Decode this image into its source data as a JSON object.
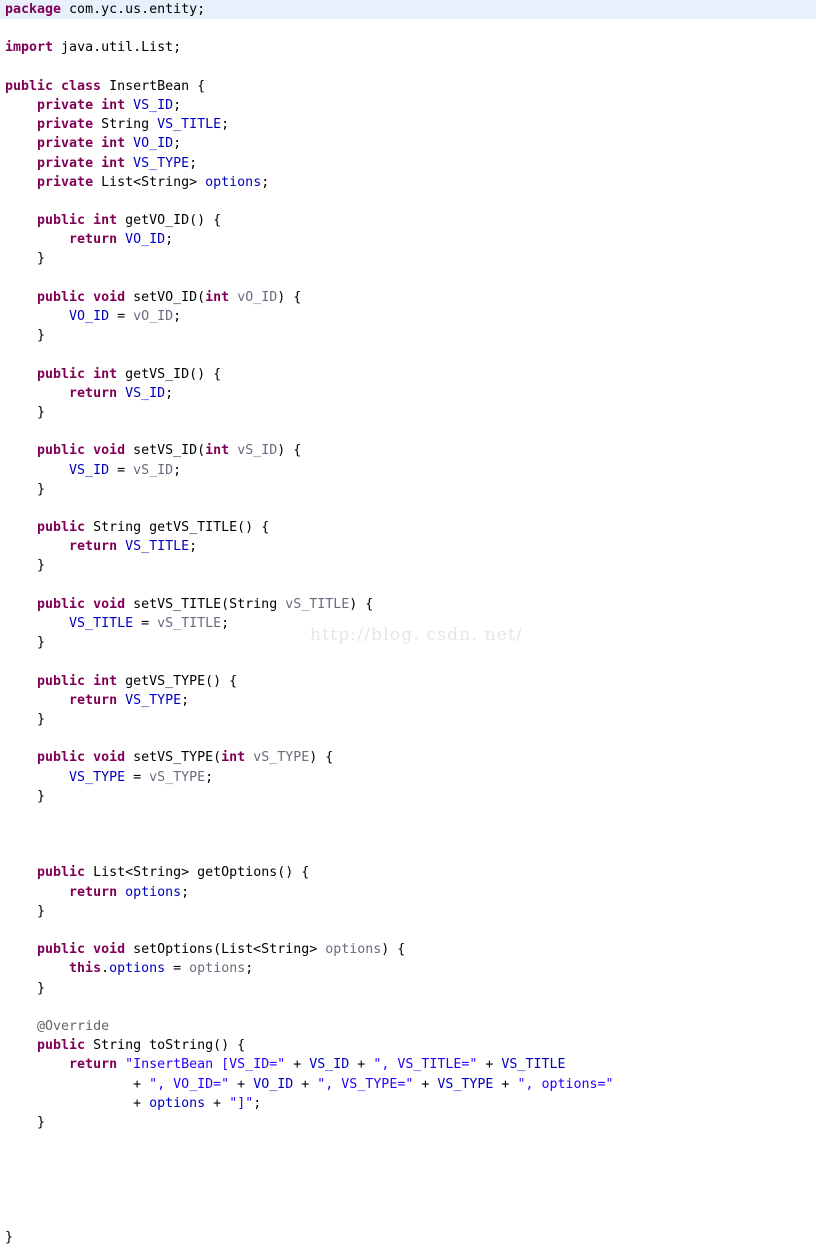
{
  "editor": {
    "language": "java",
    "theme": "eclipse-light",
    "background_color": "#ffffff",
    "current_line_highlight_color": "#e8f0fc",
    "colors": {
      "keyword": "#7f0055",
      "field": "#0000c0",
      "string": "#2a00ff",
      "parameter": "#6a6a80",
      "annotation": "#646464",
      "plain": "#000000"
    }
  },
  "watermark": {
    "text": "http://blog. csdn. net/"
  },
  "code": {
    "lines": [
      {
        "n": 1,
        "highlight": true,
        "tokens": [
          {
            "t": "kw",
            "v": "package"
          },
          {
            "t": "pln",
            "v": " com.yc.us.entity;"
          }
        ]
      },
      {
        "n": 2,
        "highlight": false,
        "tokens": []
      },
      {
        "n": 3,
        "highlight": false,
        "tokens": [
          {
            "t": "kw",
            "v": "import"
          },
          {
            "t": "pln",
            "v": " java.util.List;"
          }
        ]
      },
      {
        "n": 4,
        "highlight": false,
        "tokens": []
      },
      {
        "n": 5,
        "highlight": false,
        "tokens": [
          {
            "t": "kw",
            "v": "public class"
          },
          {
            "t": "pln",
            "v": " InsertBean {"
          }
        ]
      },
      {
        "n": 6,
        "highlight": false,
        "tokens": [
          {
            "t": "pln",
            "v": "    "
          },
          {
            "t": "kw",
            "v": "private int"
          },
          {
            "t": "pln",
            "v": " "
          },
          {
            "t": "fld",
            "v": "VS_ID"
          },
          {
            "t": "pln",
            "v": ";"
          }
        ]
      },
      {
        "n": 7,
        "highlight": false,
        "tokens": [
          {
            "t": "pln",
            "v": "    "
          },
          {
            "t": "kw",
            "v": "private"
          },
          {
            "t": "pln",
            "v": " String "
          },
          {
            "t": "fld",
            "v": "VS_TITLE"
          },
          {
            "t": "pln",
            "v": ";"
          }
        ]
      },
      {
        "n": 8,
        "highlight": false,
        "tokens": [
          {
            "t": "pln",
            "v": "    "
          },
          {
            "t": "kw",
            "v": "private int"
          },
          {
            "t": "pln",
            "v": " "
          },
          {
            "t": "fld",
            "v": "VO_ID"
          },
          {
            "t": "pln",
            "v": ";"
          }
        ]
      },
      {
        "n": 9,
        "highlight": false,
        "tokens": [
          {
            "t": "pln",
            "v": "    "
          },
          {
            "t": "kw",
            "v": "private int"
          },
          {
            "t": "pln",
            "v": " "
          },
          {
            "t": "fld",
            "v": "VS_TYPE"
          },
          {
            "t": "pln",
            "v": ";"
          }
        ]
      },
      {
        "n": 10,
        "highlight": false,
        "tokens": [
          {
            "t": "pln",
            "v": "    "
          },
          {
            "t": "kw",
            "v": "private"
          },
          {
            "t": "pln",
            "v": " List<String> "
          },
          {
            "t": "fld",
            "v": "options"
          },
          {
            "t": "pln",
            "v": ";"
          }
        ]
      },
      {
        "n": 11,
        "highlight": false,
        "tokens": []
      },
      {
        "n": 12,
        "highlight": false,
        "tokens": [
          {
            "t": "pln",
            "v": "    "
          },
          {
            "t": "kw",
            "v": "public int"
          },
          {
            "t": "pln",
            "v": " getVO_ID() {"
          }
        ]
      },
      {
        "n": 13,
        "highlight": false,
        "tokens": [
          {
            "t": "pln",
            "v": "        "
          },
          {
            "t": "kw",
            "v": "return"
          },
          {
            "t": "pln",
            "v": " "
          },
          {
            "t": "fld",
            "v": "VO_ID"
          },
          {
            "t": "pln",
            "v": ";"
          }
        ]
      },
      {
        "n": 14,
        "highlight": false,
        "tokens": [
          {
            "t": "pln",
            "v": "    }"
          }
        ]
      },
      {
        "n": 15,
        "highlight": false,
        "tokens": []
      },
      {
        "n": 16,
        "highlight": false,
        "tokens": [
          {
            "t": "pln",
            "v": "    "
          },
          {
            "t": "kw",
            "v": "public void"
          },
          {
            "t": "pln",
            "v": " setVO_ID("
          },
          {
            "t": "kw",
            "v": "int"
          },
          {
            "t": "pln",
            "v": " "
          },
          {
            "t": "par",
            "v": "vO_ID"
          },
          {
            "t": "pln",
            "v": ") {"
          }
        ]
      },
      {
        "n": 17,
        "highlight": false,
        "tokens": [
          {
            "t": "pln",
            "v": "        "
          },
          {
            "t": "fld",
            "v": "VO_ID"
          },
          {
            "t": "pln",
            "v": " = "
          },
          {
            "t": "par",
            "v": "vO_ID"
          },
          {
            "t": "pln",
            "v": ";"
          }
        ]
      },
      {
        "n": 18,
        "highlight": false,
        "tokens": [
          {
            "t": "pln",
            "v": "    }"
          }
        ]
      },
      {
        "n": 19,
        "highlight": false,
        "tokens": []
      },
      {
        "n": 20,
        "highlight": false,
        "tokens": [
          {
            "t": "pln",
            "v": "    "
          },
          {
            "t": "kw",
            "v": "public int"
          },
          {
            "t": "pln",
            "v": " getVS_ID() {"
          }
        ]
      },
      {
        "n": 21,
        "highlight": false,
        "tokens": [
          {
            "t": "pln",
            "v": "        "
          },
          {
            "t": "kw",
            "v": "return"
          },
          {
            "t": "pln",
            "v": " "
          },
          {
            "t": "fld",
            "v": "VS_ID"
          },
          {
            "t": "pln",
            "v": ";"
          }
        ]
      },
      {
        "n": 22,
        "highlight": false,
        "tokens": [
          {
            "t": "pln",
            "v": "    }"
          }
        ]
      },
      {
        "n": 23,
        "highlight": false,
        "tokens": []
      },
      {
        "n": 24,
        "highlight": false,
        "tokens": [
          {
            "t": "pln",
            "v": "    "
          },
          {
            "t": "kw",
            "v": "public void"
          },
          {
            "t": "pln",
            "v": " setVS_ID("
          },
          {
            "t": "kw",
            "v": "int"
          },
          {
            "t": "pln",
            "v": " "
          },
          {
            "t": "par",
            "v": "vS_ID"
          },
          {
            "t": "pln",
            "v": ") {"
          }
        ]
      },
      {
        "n": 25,
        "highlight": false,
        "tokens": [
          {
            "t": "pln",
            "v": "        "
          },
          {
            "t": "fld",
            "v": "VS_ID"
          },
          {
            "t": "pln",
            "v": " = "
          },
          {
            "t": "par",
            "v": "vS_ID"
          },
          {
            "t": "pln",
            "v": ";"
          }
        ]
      },
      {
        "n": 26,
        "highlight": false,
        "tokens": [
          {
            "t": "pln",
            "v": "    }"
          }
        ]
      },
      {
        "n": 27,
        "highlight": false,
        "tokens": []
      },
      {
        "n": 28,
        "highlight": false,
        "tokens": [
          {
            "t": "pln",
            "v": "    "
          },
          {
            "t": "kw",
            "v": "public"
          },
          {
            "t": "pln",
            "v": " String getVS_TITLE() {"
          }
        ]
      },
      {
        "n": 29,
        "highlight": false,
        "tokens": [
          {
            "t": "pln",
            "v": "        "
          },
          {
            "t": "kw",
            "v": "return"
          },
          {
            "t": "pln",
            "v": " "
          },
          {
            "t": "fld",
            "v": "VS_TITLE"
          },
          {
            "t": "pln",
            "v": ";"
          }
        ]
      },
      {
        "n": 30,
        "highlight": false,
        "tokens": [
          {
            "t": "pln",
            "v": "    }"
          }
        ]
      },
      {
        "n": 31,
        "highlight": false,
        "tokens": []
      },
      {
        "n": 32,
        "highlight": false,
        "tokens": [
          {
            "t": "pln",
            "v": "    "
          },
          {
            "t": "kw",
            "v": "public void"
          },
          {
            "t": "pln",
            "v": " setVS_TITLE(String "
          },
          {
            "t": "par",
            "v": "vS_TITLE"
          },
          {
            "t": "pln",
            "v": ") {"
          }
        ]
      },
      {
        "n": 33,
        "highlight": false,
        "tokens": [
          {
            "t": "pln",
            "v": "        "
          },
          {
            "t": "fld",
            "v": "VS_TITLE"
          },
          {
            "t": "pln",
            "v": " = "
          },
          {
            "t": "par",
            "v": "vS_TITLE"
          },
          {
            "t": "pln",
            "v": ";"
          }
        ]
      },
      {
        "n": 34,
        "highlight": false,
        "tokens": [
          {
            "t": "pln",
            "v": "    }"
          }
        ]
      },
      {
        "n": 35,
        "highlight": false,
        "tokens": []
      },
      {
        "n": 36,
        "highlight": false,
        "tokens": [
          {
            "t": "pln",
            "v": "    "
          },
          {
            "t": "kw",
            "v": "public int"
          },
          {
            "t": "pln",
            "v": " getVS_TYPE() {"
          }
        ]
      },
      {
        "n": 37,
        "highlight": false,
        "tokens": [
          {
            "t": "pln",
            "v": "        "
          },
          {
            "t": "kw",
            "v": "return"
          },
          {
            "t": "pln",
            "v": " "
          },
          {
            "t": "fld",
            "v": "VS_TYPE"
          },
          {
            "t": "pln",
            "v": ";"
          }
        ]
      },
      {
        "n": 38,
        "highlight": false,
        "tokens": [
          {
            "t": "pln",
            "v": "    }"
          }
        ]
      },
      {
        "n": 39,
        "highlight": false,
        "tokens": []
      },
      {
        "n": 40,
        "highlight": false,
        "tokens": [
          {
            "t": "pln",
            "v": "    "
          },
          {
            "t": "kw",
            "v": "public void"
          },
          {
            "t": "pln",
            "v": " setVS_TYPE("
          },
          {
            "t": "kw",
            "v": "int"
          },
          {
            "t": "pln",
            "v": " "
          },
          {
            "t": "par",
            "v": "vS_TYPE"
          },
          {
            "t": "pln",
            "v": ") {"
          }
        ]
      },
      {
        "n": 41,
        "highlight": false,
        "tokens": [
          {
            "t": "pln",
            "v": "        "
          },
          {
            "t": "fld",
            "v": "VS_TYPE"
          },
          {
            "t": "pln",
            "v": " = "
          },
          {
            "t": "par",
            "v": "vS_TYPE"
          },
          {
            "t": "pln",
            "v": ";"
          }
        ]
      },
      {
        "n": 42,
        "highlight": false,
        "tokens": [
          {
            "t": "pln",
            "v": "    }"
          }
        ]
      },
      {
        "n": 43,
        "highlight": false,
        "tokens": []
      },
      {
        "n": 44,
        "highlight": false,
        "tokens": []
      },
      {
        "n": 45,
        "highlight": false,
        "tokens": []
      },
      {
        "n": 46,
        "highlight": false,
        "tokens": [
          {
            "t": "pln",
            "v": "    "
          },
          {
            "t": "kw",
            "v": "public"
          },
          {
            "t": "pln",
            "v": " List<String> getOptions() {"
          }
        ]
      },
      {
        "n": 47,
        "highlight": false,
        "tokens": [
          {
            "t": "pln",
            "v": "        "
          },
          {
            "t": "kw",
            "v": "return"
          },
          {
            "t": "pln",
            "v": " "
          },
          {
            "t": "fld",
            "v": "options"
          },
          {
            "t": "pln",
            "v": ";"
          }
        ]
      },
      {
        "n": 48,
        "highlight": false,
        "tokens": [
          {
            "t": "pln",
            "v": "    }"
          }
        ]
      },
      {
        "n": 49,
        "highlight": false,
        "tokens": []
      },
      {
        "n": 50,
        "highlight": false,
        "tokens": [
          {
            "t": "pln",
            "v": "    "
          },
          {
            "t": "kw",
            "v": "public void"
          },
          {
            "t": "pln",
            "v": " setOptions(List<String> "
          },
          {
            "t": "par",
            "v": "options"
          },
          {
            "t": "pln",
            "v": ") {"
          }
        ]
      },
      {
        "n": 51,
        "highlight": false,
        "tokens": [
          {
            "t": "pln",
            "v": "        "
          },
          {
            "t": "kw",
            "v": "this"
          },
          {
            "t": "pln",
            "v": "."
          },
          {
            "t": "fld",
            "v": "options"
          },
          {
            "t": "pln",
            "v": " = "
          },
          {
            "t": "par",
            "v": "options"
          },
          {
            "t": "pln",
            "v": ";"
          }
        ]
      },
      {
        "n": 52,
        "highlight": false,
        "tokens": [
          {
            "t": "pln",
            "v": "    }"
          }
        ]
      },
      {
        "n": 53,
        "highlight": false,
        "tokens": []
      },
      {
        "n": 54,
        "highlight": false,
        "tokens": [
          {
            "t": "pln",
            "v": "    "
          },
          {
            "t": "ann",
            "v": "@Override"
          }
        ]
      },
      {
        "n": 55,
        "highlight": false,
        "tokens": [
          {
            "t": "pln",
            "v": "    "
          },
          {
            "t": "kw",
            "v": "public"
          },
          {
            "t": "pln",
            "v": " String toString() {"
          }
        ]
      },
      {
        "n": 56,
        "highlight": false,
        "tokens": [
          {
            "t": "pln",
            "v": "        "
          },
          {
            "t": "kw",
            "v": "return"
          },
          {
            "t": "pln",
            "v": " "
          },
          {
            "t": "str",
            "v": "\"InsertBean [VS_ID=\""
          },
          {
            "t": "pln",
            "v": " + "
          },
          {
            "t": "fld",
            "v": "VS_ID"
          },
          {
            "t": "pln",
            "v": " + "
          },
          {
            "t": "str",
            "v": "\", VS_TITLE=\""
          },
          {
            "t": "pln",
            "v": " + "
          },
          {
            "t": "fld",
            "v": "VS_TITLE"
          }
        ]
      },
      {
        "n": 57,
        "highlight": false,
        "tokens": [
          {
            "t": "pln",
            "v": "                + "
          },
          {
            "t": "str",
            "v": "\", VO_ID=\""
          },
          {
            "t": "pln",
            "v": " + "
          },
          {
            "t": "fld",
            "v": "VO_ID"
          },
          {
            "t": "pln",
            "v": " + "
          },
          {
            "t": "str",
            "v": "\", VS_TYPE=\""
          },
          {
            "t": "pln",
            "v": " + "
          },
          {
            "t": "fld",
            "v": "VS_TYPE"
          },
          {
            "t": "pln",
            "v": " + "
          },
          {
            "t": "str",
            "v": "\", options=\""
          }
        ]
      },
      {
        "n": 58,
        "highlight": false,
        "tokens": [
          {
            "t": "pln",
            "v": "                + "
          },
          {
            "t": "fld",
            "v": "options"
          },
          {
            "t": "pln",
            "v": " + "
          },
          {
            "t": "str",
            "v": "\"]\""
          },
          {
            "t": "pln",
            "v": ";"
          }
        ]
      },
      {
        "n": 59,
        "highlight": false,
        "tokens": [
          {
            "t": "pln",
            "v": "    }"
          }
        ]
      },
      {
        "n": 60,
        "highlight": false,
        "tokens": []
      },
      {
        "n": 61,
        "highlight": false,
        "tokens": []
      },
      {
        "n": 62,
        "highlight": false,
        "tokens": []
      },
      {
        "n": 63,
        "highlight": false,
        "tokens": []
      },
      {
        "n": 64,
        "highlight": false,
        "tokens": []
      },
      {
        "n": 65,
        "highlight": false,
        "tokens": [
          {
            "t": "pln",
            "v": "}"
          }
        ]
      }
    ]
  }
}
